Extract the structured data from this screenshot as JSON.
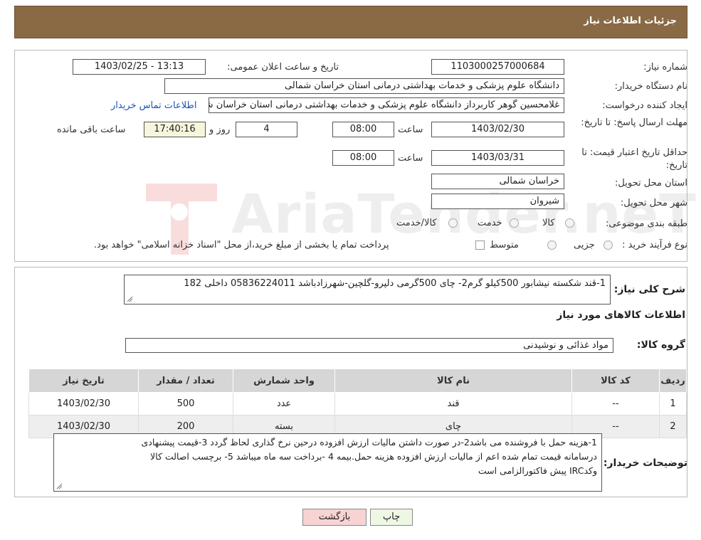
{
  "header": {
    "title": "جزئیات اطلاعات نیاز"
  },
  "labels": {
    "need_number": "شماره نیاز:",
    "announce_datetime": "تاریخ و ساعت اعلان عمومی:",
    "buyer_org": "نام دستگاه خریدار:",
    "requester": "ایجاد کننده درخواست:",
    "reply_deadline": "مهلت ارسال پاسخ: تا تاریخ:",
    "time_word": "ساعت",
    "day_word": "روز و",
    "remaining": "ساعت باقی مانده",
    "price_validity": "حداقل تاریخ اعتبار قیمت: تا تاریخ:",
    "province": "استان محل تحویل:",
    "city": "شهر محل تحویل:",
    "category": "طبقه بندی موضوعی:",
    "process_type": "نوع فرآیند خرید :"
  },
  "values": {
    "need_number": "1103000257000684",
    "announce_datetime": "1403/02/25 - 13:13",
    "buyer_org": "دانشگاه علوم پزشکی و خدمات بهداشتی درمانی استان خراسان شمالی",
    "requester": "غلامحسین گوهر کاربرداز  دانشگاه علوم پزشکی و خدمات بهداشتی درمانی استان خراسان شمالی",
    "contact_link": "اطلاعات تماس خریدار",
    "reply_date": "1403/02/30",
    "reply_time": "08:00",
    "days_left": "4",
    "time_left": "17:40:16",
    "validity_date": "1403/03/31",
    "validity_time": "08:00",
    "province": "خراسان شمالی",
    "city": "شیروان"
  },
  "category_options": [
    "کالا",
    "خدمت",
    "کالا/خدمت"
  ],
  "process_options": [
    "جزیی",
    "متوسط"
  ],
  "process_note": "پرداخت تمام یا بخشی از مبلغ خرید،از محل \"اسناد خزانه اسلامی\" خواهد بود.",
  "description": {
    "label": "شرح کلی نیاز:",
    "text": "1-قند شکسته نیشابور 500کیلو گرم2- چای 500گرمی دلپرو-گلچین-شهرزادباشد 05836224011 داخلی 182"
  },
  "goods_section": {
    "title": "اطلاعات کالاهای مورد نیاز",
    "group_label": "گروه کالا:",
    "group_value": "مواد غذائی و نوشیدنی"
  },
  "table": {
    "headers": [
      "ردیف",
      "کد کالا",
      "نام کالا",
      "واحد شمارش",
      "تعداد / مقدار",
      "تاریخ نیاز"
    ],
    "rows": [
      [
        "1",
        "--",
        "قند",
        "عدد",
        "500",
        "1403/02/30"
      ],
      [
        "2",
        "--",
        "چای",
        "بسته",
        "200",
        "1403/02/30"
      ]
    ]
  },
  "buyer_notes": {
    "label": "توضیحات خریدار:",
    "line1": "1-هزینه حمل با فروشنده می باشد2-در صورت داشتن مالیات ارزش افزوده درحین نرخ گذاری لحاظ گردد 3-قیمت پیشنهادی",
    "line2": "درسامانه  قیمت تمام شده اعم از مالیات ارزش افزوده هزینه حمل.بیمه  4  -برداخت سه ماه میباشد 5- برچسب اصالت کالا",
    "line3": "وکدIRC پیش فاکتورالزامی است"
  },
  "buttons": {
    "print": "چاپ",
    "back": "بازگشت"
  },
  "watermark": {
    "text": "AriaTender.neT"
  },
  "colors": {
    "header_bg": "#8a6a45",
    "link": "#1a55b5",
    "back_button_bg": "#f7d3d3",
    "print_button_bg": "#eef7e4"
  }
}
